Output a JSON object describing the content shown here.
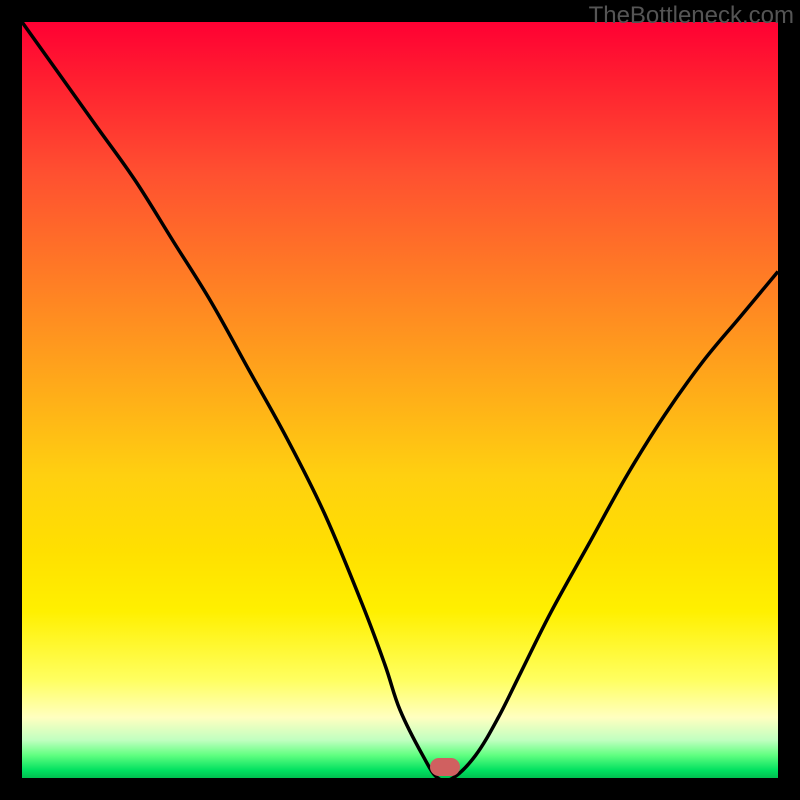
{
  "watermark": "TheBottleneck.com",
  "chart_data": {
    "type": "line",
    "title": "",
    "xlabel": "",
    "ylabel": "",
    "xlim": [
      0,
      100
    ],
    "ylim": [
      0,
      100
    ],
    "gradient_meaning": "bottleneck severity (red=high, green=low)",
    "series": [
      {
        "name": "bottleneck-curve",
        "x": [
          0,
          5,
          10,
          15,
          20,
          25,
          30,
          35,
          40,
          45,
          48,
          50,
          53,
          55,
          57,
          60,
          63,
          66,
          70,
          75,
          80,
          85,
          90,
          95,
          100
        ],
        "y": [
          100,
          93,
          86,
          79,
          71,
          63,
          54,
          45,
          35,
          23,
          15,
          9,
          3,
          0,
          0,
          3,
          8,
          14,
          22,
          31,
          40,
          48,
          55,
          61,
          67
        ]
      }
    ],
    "annotations": [
      {
        "name": "optimal-point",
        "x": 56,
        "y": 1.5,
        "shape": "rounded-rect",
        "color": "#d06060"
      }
    ]
  }
}
